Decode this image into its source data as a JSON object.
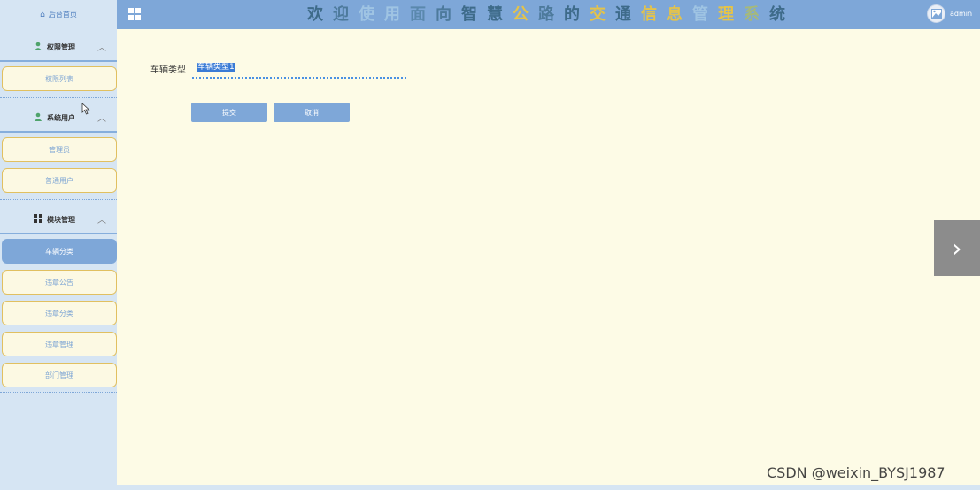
{
  "header": {
    "home_label": "后台首页",
    "title_chars": [
      "欢",
      "迎",
      "使",
      "用",
      "面",
      "向",
      "智",
      "慧",
      "公",
      "路",
      "的",
      "交",
      "通",
      "信",
      "息",
      "管",
      "理",
      "系",
      "统"
    ],
    "title_colors": [
      "#3e6b8a",
      "#4d7a9c",
      "#9fc4e3",
      "#9fc4e3",
      "#5a88ad",
      "#4d7a9c",
      "#3e6b8a",
      "#3e6b8a",
      "#e4c34a",
      "#4d7a9c",
      "#3e6b8a",
      "#e4c34a",
      "#3e6b8a",
      "#e4c34a",
      "#e4c34a",
      "#9fc4e3",
      "#e4c34a",
      "#a6b97a",
      "#3e6b8a"
    ],
    "username": "admin"
  },
  "sidebar": {
    "groups": [
      {
        "label": "权限管理",
        "icon": "user-icon",
        "items": [
          {
            "label": "权限列表",
            "active": false
          }
        ]
      },
      {
        "label": "系统用户",
        "icon": "user-icon",
        "items": [
          {
            "label": "管理员",
            "active": false
          },
          {
            "label": "普通用户",
            "active": false
          }
        ]
      },
      {
        "label": "模块管理",
        "icon": "grid-icon",
        "items": [
          {
            "label": "车辆分类",
            "active": true
          },
          {
            "label": "违章公告",
            "active": false
          },
          {
            "label": "违章分类",
            "active": false
          },
          {
            "label": "违章管理",
            "active": false
          },
          {
            "label": "部门管理",
            "active": false
          }
        ]
      }
    ]
  },
  "form": {
    "field_label": "车辆类型",
    "field_value": "车辆类型1",
    "submit_label": "提交",
    "cancel_label": "取消"
  },
  "watermark": "CSDN @weixin_BYSJ1987",
  "colors": {
    "accent": "#7ea7d8",
    "sidebar_bg": "#d6e5f3",
    "main_bg": "#fdfbe6",
    "item_border": "#e1c060"
  }
}
